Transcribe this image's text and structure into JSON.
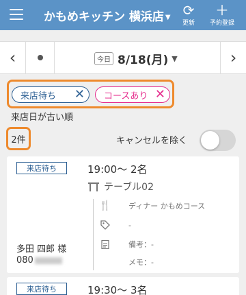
{
  "header": {
    "store_name": "かもめキッチン 横浜店",
    "refresh_label": "更新",
    "reserve_label": "予約登録"
  },
  "datebar": {
    "today_badge": "今日",
    "date": "8/18(月)"
  },
  "filters": {
    "chips": [
      {
        "label": "来店待ち",
        "color": "#2c5f93"
      },
      {
        "label": "コースあり",
        "color": "#e52c8d"
      }
    ],
    "sort_label": "来店日が古い順",
    "count": "2件",
    "cancel_toggle_label": "キャンセルを除く",
    "cancel_toggle_on": false
  },
  "reservations": [
    {
      "status": "来店待ち",
      "time_people": "19:00～ 2名",
      "table": "テーブル02",
      "course": "ディナー かもめコース",
      "tags": "-",
      "note": "備考：-",
      "memo": "メモ：-",
      "guest_name": "多田 四郎 様",
      "phone_prefix": "080"
    },
    {
      "status": "来店待ち",
      "time_people": "19:30～ 3名"
    }
  ],
  "colors": {
    "header_bg": "#5b93c7",
    "highlight": "#ee8a2d",
    "status_blue": "#2c5f93",
    "course_pink": "#e52c8d"
  }
}
